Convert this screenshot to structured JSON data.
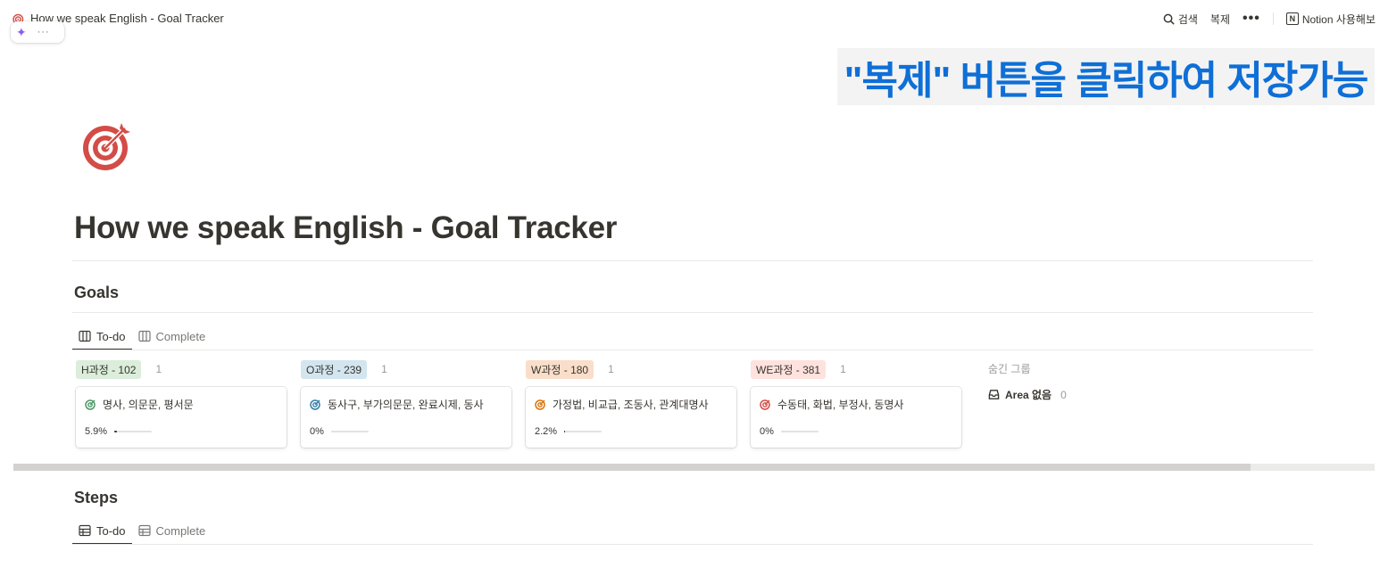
{
  "topbar": {
    "page_title": "How we speak English - Goal Tracker",
    "ai_more": "···",
    "search_label": "검색",
    "duplicate_label": "복제",
    "more_label": "•••",
    "try_notion_label": "Notion 사용해보"
  },
  "banner": {
    "text": "\"복제\" 버튼을 클릭하여 저장가능",
    "color": "#0f6fd6"
  },
  "page": {
    "icon": "target-icon",
    "title": "How we speak English - Goal Tracker"
  },
  "goals": {
    "heading": "Goals",
    "tabs": [
      {
        "label": "To-do",
        "icon": "board-icon",
        "active": true
      },
      {
        "label": "Complete",
        "icon": "board-icon",
        "active": false
      }
    ],
    "columns": [
      {
        "badge": "H과정 - 102",
        "count": "1",
        "badge_color": "#dbeddb",
        "card": {
          "title": "명사, 의문문, 평서문",
          "progress_text": "5.9%",
          "progress": 0.059,
          "icon_color": "#4f9768"
        }
      },
      {
        "badge": "O과정 - 239",
        "count": "1",
        "badge_color": "#d3e5ef",
        "card": {
          "title": "동사구, 부가의문문, 완료시제, 동사",
          "progress_text": "0%",
          "progress": 0,
          "icon_color": "#337ea9"
        }
      },
      {
        "badge": "W과정 - 180",
        "count": "1",
        "badge_color": "#fadec9",
        "card": {
          "title": "가정법, 비교급, 조동사, 관계대명사",
          "progress_text": "2.2%",
          "progress": 0.022,
          "icon_color": "#d9730d"
        }
      },
      {
        "badge": "WE과정 - 381",
        "count": "1",
        "badge_color": "#ffe2dd",
        "card": {
          "title": "수동태, 화법, 부정사, 동명사",
          "progress_text": "0%",
          "progress": 0,
          "icon_color": "#d44c47"
        }
      }
    ],
    "hidden_groups_label": "숨긴 그룹",
    "no_area_label": "Area 없음",
    "no_area_count": "0"
  },
  "steps": {
    "heading": "Steps",
    "tabs": [
      {
        "label": "To-do",
        "icon": "table-icon",
        "active": true
      },
      {
        "label": "Complete",
        "icon": "table-icon",
        "active": false
      }
    ]
  }
}
